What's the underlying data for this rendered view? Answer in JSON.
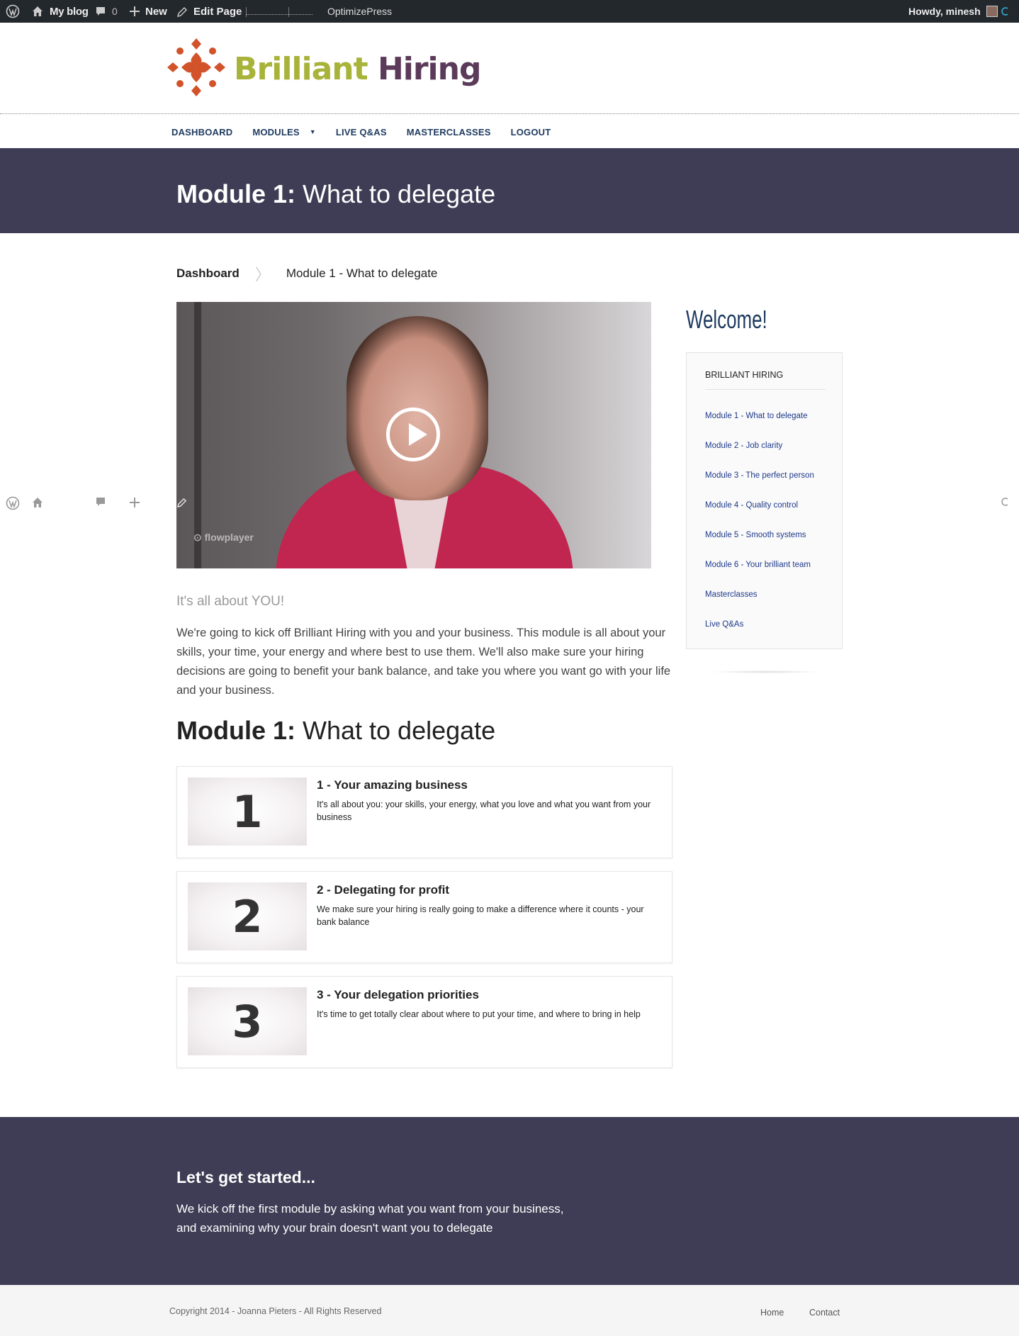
{
  "admin_bar": {
    "site_name": "My blog",
    "comments_count": "0",
    "new_label": "New",
    "edit_label": "Edit Page",
    "plugin_label": "OptimizePress",
    "greeting": "Howdy, minesh"
  },
  "logo": {
    "part1": "Brilliant",
    "part2": "Hiring"
  },
  "nav": {
    "items": [
      {
        "label": "DASHBOARD"
      },
      {
        "label": "MODULES"
      },
      {
        "label": "LIVE Q&AS"
      },
      {
        "label": "MASTERCLASSES"
      },
      {
        "label": "LOGOUT"
      }
    ]
  },
  "banner": {
    "title_bold": "Module 1:",
    "title_rest": " What to delegate"
  },
  "breadcrumb": {
    "home": "Dashboard",
    "current": "Module 1 - What to delegate"
  },
  "video": {
    "brand": "flowplayer"
  },
  "content": {
    "subhead": "It's all about YOU!",
    "intro": "We're going to kick off Brilliant Hiring with you and your business. This module is all about your skills, your time, your energy and where best to use them. We'll also make sure your hiring decisions are going to benefit your bank balance, and take you where you want go with your life and your business.",
    "section_bold": "Module 1:",
    "section_rest": " What to delegate",
    "cards": [
      {
        "number": "1",
        "title": "1 - Your amazing business",
        "desc": "It's all about you: your skills, your energy, what you love and what you want from your business"
      },
      {
        "number": "2",
        "title": "2 - Delegating for profit",
        "desc": "We make sure your hiring is really going to make a difference where it counts - your bank balance"
      },
      {
        "number": "3",
        "title": "3 - Your delegation priorities",
        "desc": "It's time to get totally clear about where to put your time, and where to bring in help"
      }
    ]
  },
  "sidebar": {
    "welcome": "Welcome!",
    "box_title": "BRILLIANT HIRING",
    "links": [
      {
        "label": "Module 1 - What to delegate"
      },
      {
        "label": "Module 2 - Job clarity"
      },
      {
        "label": "Module 3 - The perfect person"
      },
      {
        "label": "Module 4 - Quality control"
      },
      {
        "label": "Module 5 - Smooth systems"
      },
      {
        "label": "Module 6 - Your brilliant team"
      },
      {
        "label": "Masterclasses"
      },
      {
        "label": "Live Q&As"
      }
    ]
  },
  "cta": {
    "title": "Let's get started...",
    "line1": "We kick off the first module by asking what you want from your business,",
    "line2": "and examining why your brain doesn't want you to delegate"
  },
  "footer": {
    "copyright": "Copyright 2014 - Joanna Pieters - All Rights Reserved",
    "links": [
      {
        "label": "Home"
      },
      {
        "label": "Contact"
      }
    ]
  },
  "colors": {
    "banner": "#3e3d55",
    "nav_text": "#1e3a5f",
    "logo_green": "#a8b33a",
    "logo_purple": "#5b3a5a",
    "logo_orange": "#d2532a"
  }
}
